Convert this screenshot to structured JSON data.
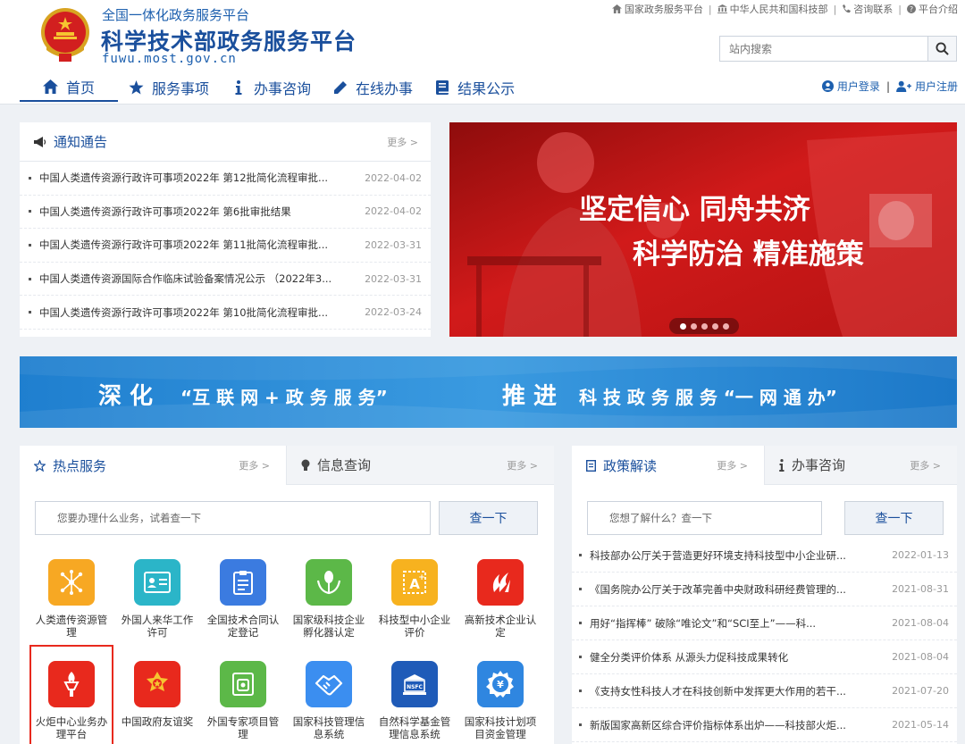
{
  "header": {
    "subtitle": "全国一体化政务服务平台",
    "title": "科学技术部政务服务平台",
    "domain": "fuwu.most.gov.cn",
    "top_links": [
      {
        "icon": "home-icon",
        "label": "国家政务服务平台"
      },
      {
        "icon": "building-icon",
        "label": "中华人民共和国科技部"
      },
      {
        "icon": "phone-icon",
        "label": "咨询联系"
      },
      {
        "icon": "question-icon",
        "label": "平台介绍"
      }
    ],
    "search_placeholder": "站内搜索",
    "nav": [
      {
        "icon": "home-icon",
        "label": "首页"
      },
      {
        "icon": "star-icon",
        "label": "服务事项"
      },
      {
        "icon": "info-icon",
        "label": "办事咨询"
      },
      {
        "icon": "pen-icon",
        "label": "在线办事"
      },
      {
        "icon": "book-icon",
        "label": "结果公示"
      }
    ],
    "login": "用户登录",
    "register": "用户注册"
  },
  "notice": {
    "title": "通知通告",
    "more": "更多 >",
    "items": [
      {
        "text": "中国人类遗传资源行政许可事项2022年 第12批简化流程审批...",
        "date": "2022-04-02"
      },
      {
        "text": "中国人类遗传资源行政许可事项2022年 第6批审批结果",
        "date": "2022-04-02"
      },
      {
        "text": "中国人类遗传资源行政许可事项2022年 第11批简化流程审批...",
        "date": "2022-03-31"
      },
      {
        "text": "中国人类遗传资源国际合作临床试验备案情况公示 （2022年3...",
        "date": "2022-03-31"
      },
      {
        "text": "中国人类遗传资源行政许可事项2022年 第10批简化流程审批...",
        "date": "2022-03-24"
      }
    ]
  },
  "banner": {
    "line1": "坚定信心 同舟共济",
    "line2": "科学防治 精准施策"
  },
  "strip": {
    "left_a": "深 化",
    "left_b": "“互 联 网 + 政 务 服 务”",
    "right_a": "推 进",
    "right_b": "科 技 政 务 服 务 “一 网 通 办”"
  },
  "hot": {
    "tab1": "热点服务",
    "tab2": "信息查询",
    "more": "更多 >",
    "query_placeholder": "您要办理什么业务，试着查一下",
    "query_button": "查一下",
    "services": [
      {
        "label": "人类遗传资源管理",
        "icon": "network-icon",
        "color": "#f7a823"
      },
      {
        "label": "外国人来华工作许可",
        "icon": "id-card-icon",
        "color": "#2bb5c8"
      },
      {
        "label": "全国技术合同认定登记",
        "icon": "clipboard-icon",
        "color": "#3b7be0"
      },
      {
        "label": "国家级科技企业孵化器认定",
        "icon": "sprout-icon",
        "color": "#5cb848"
      },
      {
        "label": "科技型中小企业评价",
        "icon": "certificate-icon",
        "color": "#f7b21f"
      },
      {
        "label": "高新技术企业认定",
        "icon": "high-tech-icon",
        "color": "#e8291d"
      },
      {
        "label": "火炬中心业务办理平台",
        "icon": "torch-icon",
        "color": "#e8291d"
      },
      {
        "label": "中国政府友谊奖",
        "icon": "medal-icon",
        "color": "#e8291d"
      },
      {
        "label": "外国专家项目管理",
        "icon": "folder-icon",
        "color": "#5cb848"
      },
      {
        "label": "国家科技管理信息系统",
        "icon": "handshake-icon",
        "color": "#3b8ef0"
      },
      {
        "label": "自然科学基金管理信息系统",
        "icon": "nsfc-icon",
        "color": "#1f5bb8"
      },
      {
        "label": "国家科技计划项目资金管理",
        "icon": "yuan-icon",
        "color": "#2f86e0"
      }
    ]
  },
  "policy": {
    "tab1": "政策解读",
    "tab2": "办事咨询",
    "more": "更多 >",
    "query_placeholder": "您想了解什么？查一下",
    "query_button": "查一下",
    "items": [
      {
        "text": "科技部办公厅关于营造更好环境支持科技型中小企业研...",
        "date": "2022-01-13"
      },
      {
        "text": "《国务院办公厅关于改革完善中央财政科研经费管理的...",
        "date": "2021-08-31"
      },
      {
        "text": "用好“指挥棒” 破除“唯论文”和“SCI至上”——科...",
        "date": "2021-08-04"
      },
      {
        "text": "健全分类评价体系 从源头力促科技成果转化",
        "date": "2021-08-04"
      },
      {
        "text": "《支持女性科技人才在科技创新中发挥更大作用的若干...",
        "date": "2021-07-20"
      },
      {
        "text": "新版国家高新区综合评价指标体系出炉——科技部火炬...",
        "date": "2021-05-14"
      }
    ]
  }
}
